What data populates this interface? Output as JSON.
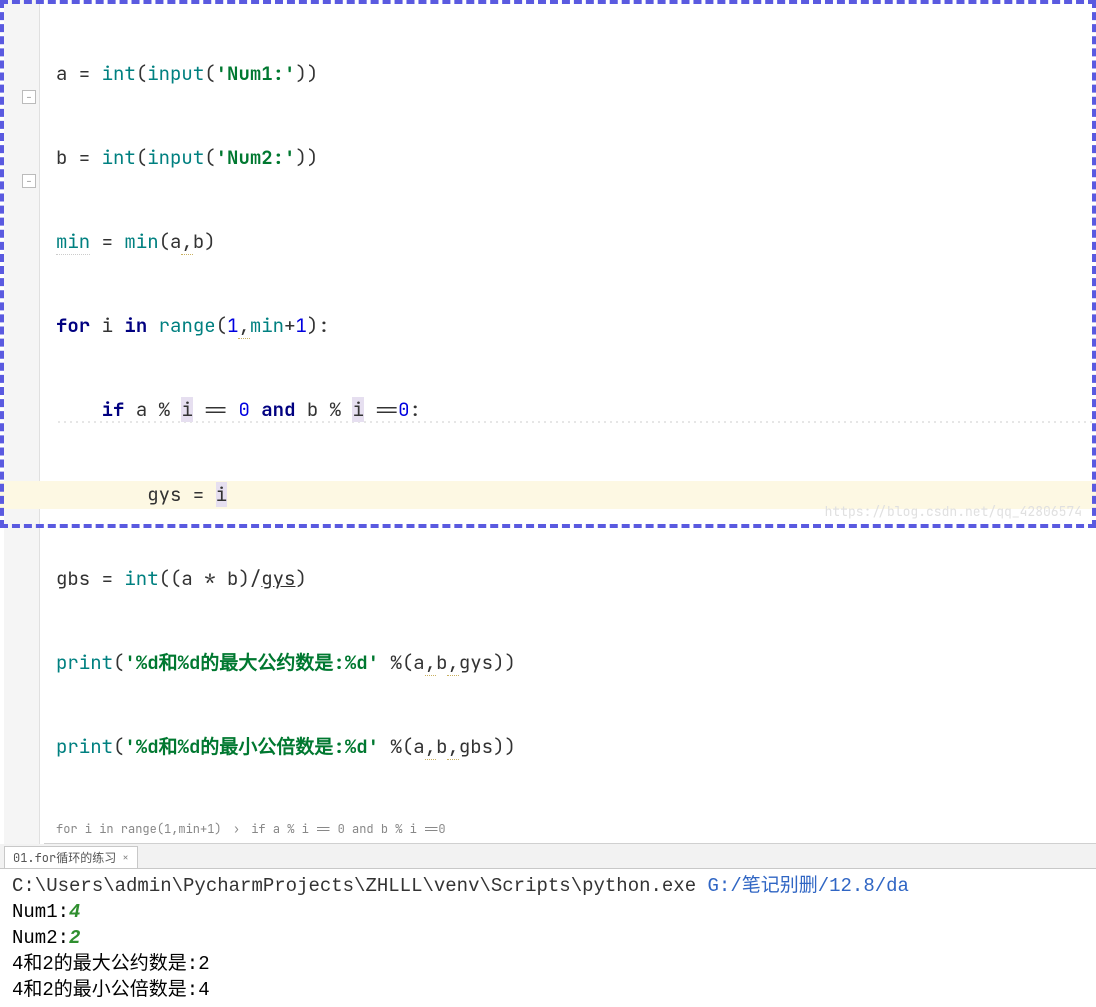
{
  "code": {
    "l1": {
      "v1": "a",
      "op1": " = ",
      "fn1": "int",
      "p1": "(",
      "fn2": "input",
      "p2": "(",
      "str": "'Num1:'",
      "p3": "))"
    },
    "l2": {
      "v1": "b",
      "op1": " = ",
      "fn1": "int",
      "p1": "(",
      "fn2": "input",
      "p2": "(",
      "str": "'Num2:'",
      "p3": "))"
    },
    "l3": {
      "v1": "min",
      "op1": " = ",
      "fn1": "min",
      "p1": "(",
      "a1": "a",
      "c": ",",
      "a2": "b",
      "p2": ")"
    },
    "l4": {
      "kw1": "for",
      "sp1": " ",
      "v1": "i",
      "sp2": " ",
      "kw2": "in",
      "sp3": " ",
      "fn1": "range",
      "p1": "(",
      "n1": "1",
      "c": ",",
      "v2": "min",
      "op": "+",
      "n2": "1",
      "p2": "):"
    },
    "l5": {
      "indent": "    ",
      "kw1": "if",
      "sp1": " ",
      "a": "a",
      "pct1": " % ",
      "i1": "i",
      "eq1": " == ",
      "z1": "0",
      "sp2": " ",
      "kw2": "and",
      "sp3": " ",
      "b": "b",
      "pct2": " % ",
      "i2": "i",
      "eq2": " ==",
      "z2": "0",
      "col": ":"
    },
    "l6": {
      "indent": "        ",
      "v1": "gys",
      "op": " = ",
      "v2": "i"
    },
    "l7": {
      "v1": "gbs",
      "op1": " = ",
      "fn": "int",
      "p1": "((",
      "a": "a",
      "mul": " * ",
      "b": "b",
      "p2": ")/",
      "gys": "gys",
      "p3": ")"
    },
    "l8": {
      "fn": "print",
      "p1": "(",
      "str": "'%d和%d的最大公约数是:%d'",
      "sp": " ",
      "pct": "%",
      "p2": "(",
      "a": "a",
      "c1": ",",
      "b": "b",
      "c2": ",",
      "g": "gys",
      "p3": "))"
    },
    "l9": {
      "fn": "print",
      "p1": "(",
      "str": "'%d和%d的最小公倍数是:%d'",
      "sp": " ",
      "pct": "%",
      "p2": "(",
      "a": "a",
      "c1": ",",
      "b": "b",
      "c2": ",",
      "g": "gbs",
      "p3": "))"
    }
  },
  "breadcrumb": {
    "part1": "for i in range(1,min+1)",
    "part2": "if a % i == 0 and b % i ==0"
  },
  "run_tab": {
    "label": "01.for循环的练习",
    "close": "×"
  },
  "console": {
    "path_pre": "C:\\Users\\admin\\PycharmProjects\\ZHLLL\\venv\\Scripts\\python.exe ",
    "path_blue": "G:/笔记别删/12.8/da",
    "prompt1": "Num1:",
    "val1": "4",
    "prompt2": "Num2:",
    "val2": "2",
    "out1": "4和2的最大公约数是:2",
    "out2": "4和2的最小公倍数是:4"
  },
  "watermark": "https://blog.csdn.net/qq_42806574",
  "fold_marks": {
    "m1": "–",
    "m2": "–"
  }
}
